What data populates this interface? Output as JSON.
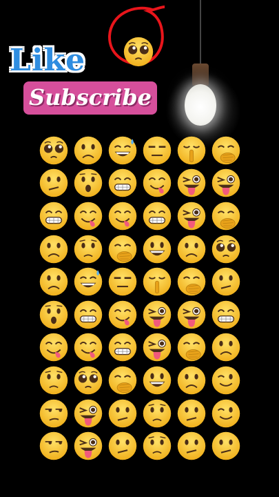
{
  "header": {
    "like_text": "Like",
    "subscribe_text": "Subscribe",
    "featured_emoji": "pleading"
  },
  "colors": {
    "like": "#2f8de0",
    "subscribe_bg": "#d64f9b",
    "circle": "#e8151b",
    "face": "#f7c52b"
  },
  "emoji_grid": [
    [
      "pleading",
      "frowning",
      "sweat",
      "neutral",
      "shush",
      "hand-over-mouth"
    ],
    [
      "confused",
      "hushed",
      "grin",
      "yum",
      "wink-tongue",
      "wink-tongue"
    ],
    [
      "grin",
      "yum",
      "yum",
      "grin",
      "wink-tongue",
      "hand-over-mouth"
    ],
    [
      "frowning",
      "worried",
      "hand-over-mouth",
      "smiley",
      "frowning",
      "pleading"
    ],
    [
      "frowning",
      "sweat",
      "neutral",
      "shush",
      "hand-over-mouth",
      "confused"
    ],
    [
      "hushed",
      "grin",
      "yum",
      "wink-tongue",
      "wink-tongue",
      "grin"
    ],
    [
      "yum",
      "yum",
      "grin",
      "wink-tongue",
      "hand-over-mouth",
      "frowning"
    ],
    [
      "worried",
      "pleading",
      "hand-over-mouth",
      "smiley",
      "frowning",
      "wink"
    ],
    [
      "unamused",
      "wink-tongue",
      "confused",
      "worried",
      "confused",
      "wink"
    ],
    [
      "unamused",
      "wink-tongue",
      "confused",
      "worried",
      "confused",
      "confused"
    ]
  ]
}
